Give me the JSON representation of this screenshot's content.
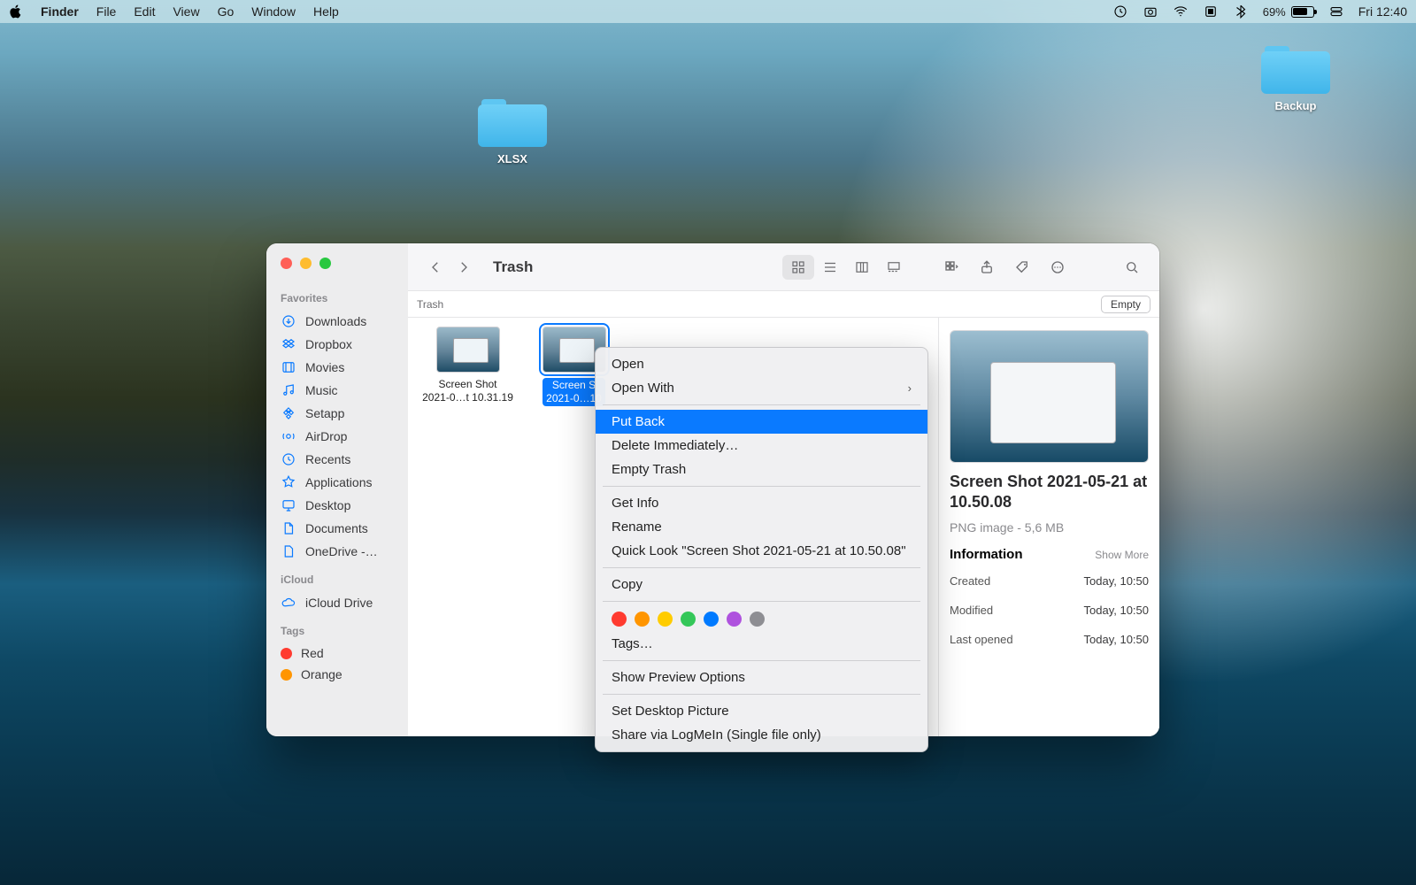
{
  "menubar": {
    "app": "Finder",
    "items": [
      "File",
      "Edit",
      "View",
      "Go",
      "Window",
      "Help"
    ],
    "battery": "69%",
    "clock": "Fri 12:40"
  },
  "desktop": {
    "xlsx": "XLSX",
    "backup": "Backup"
  },
  "finder": {
    "title": "Trash",
    "pathbar": "Trash",
    "empty_btn": "Empty",
    "sidebar": {
      "favorites_head": "Favorites",
      "favorites": [
        "Downloads",
        "Dropbox",
        "Movies",
        "Music",
        "Setapp",
        "AirDrop",
        "Recents",
        "Applications",
        "Desktop",
        "Documents",
        "OneDrive -…"
      ],
      "icloud_head": "iCloud",
      "icloud": [
        "iCloud Drive"
      ],
      "tags_head": "Tags",
      "tags": [
        {
          "name": "Red",
          "color": "#ff3b30"
        },
        {
          "name": "Orange",
          "color": "#ff9500"
        }
      ]
    },
    "files": [
      {
        "line1": "Screen Shot",
        "line2": "2021-0…t 10.31.19"
      },
      {
        "line1": "Screen S",
        "line2": "2021-0…10"
      }
    ],
    "preview": {
      "name": "Screen Shot 2021-05-21 at 10.50.08",
      "sub": "PNG image - 5,6 MB",
      "info_head": "Information",
      "show_more": "Show More",
      "rows": [
        {
          "k": "Created",
          "v": "Today, 10:50"
        },
        {
          "k": "Modified",
          "v": "Today, 10:50"
        },
        {
          "k": "Last opened",
          "v": "Today, 10:50"
        }
      ]
    }
  },
  "context": {
    "open": "Open",
    "open_with": "Open With",
    "put_back": "Put Back",
    "delete_imm": "Delete Immediately…",
    "empty_trash": "Empty Trash",
    "get_info": "Get Info",
    "rename": "Rename",
    "quick_look": "Quick Look \"Screen Shot 2021-05-21 at 10.50.08\"",
    "copy": "Copy",
    "tags": "Tags…",
    "show_preview": "Show Preview Options",
    "set_desktop": "Set Desktop Picture",
    "share_logmein": "Share via LogMeIn (Single file only)",
    "colors": [
      "#ff3b30",
      "#ff9500",
      "#ffcc00",
      "#34c759",
      "#007aff",
      "#af52de",
      "#8e8e93"
    ]
  }
}
